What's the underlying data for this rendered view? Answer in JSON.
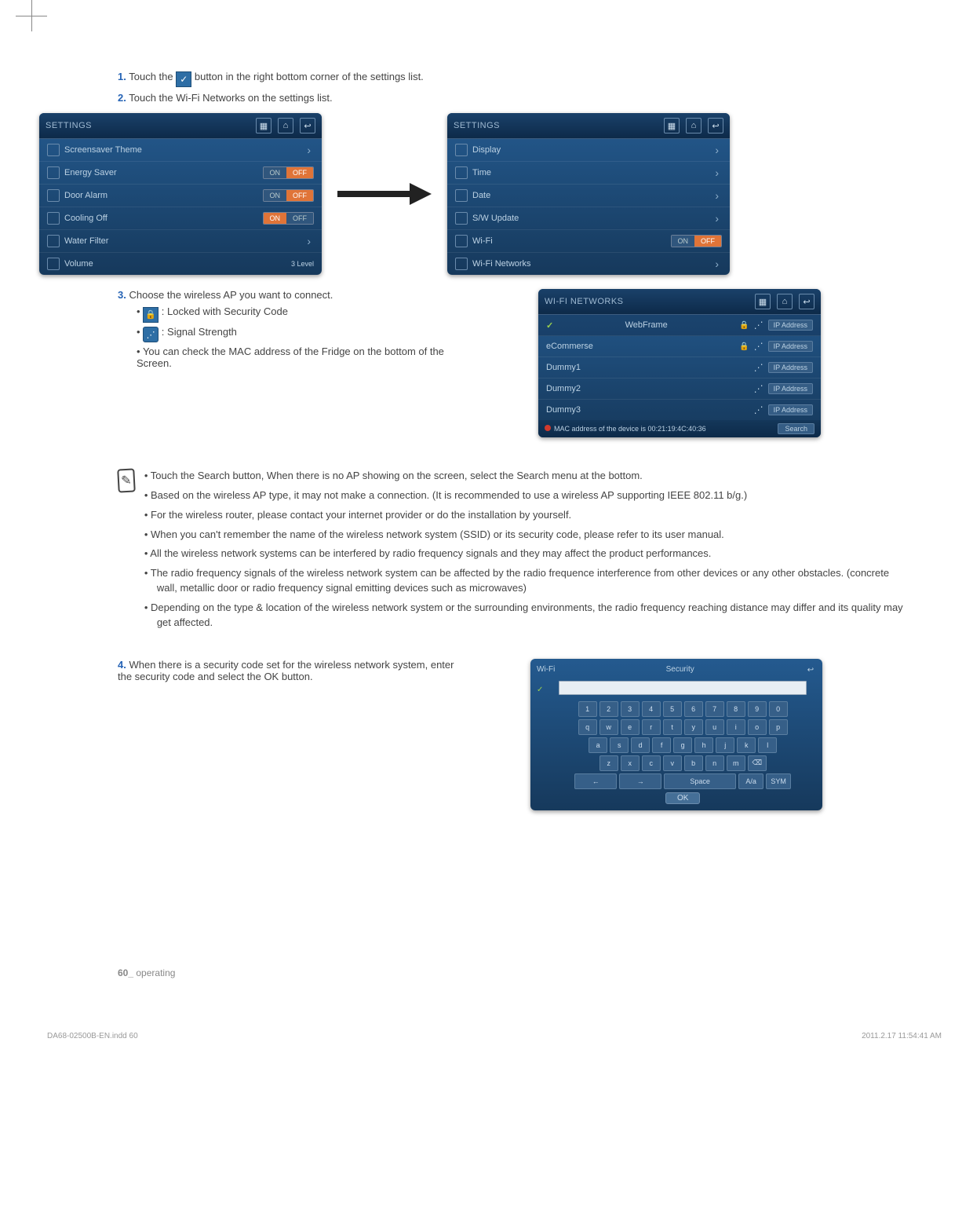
{
  "steps": {
    "s1_prefix": "1.",
    "s1a": "Touch the ",
    "s1b": " button in the right bottom corner of the settings list.",
    "s2_prefix": "2.",
    "s2": "Touch the Wi-Fi Networks on the settings list.",
    "s3_prefix": "3.",
    "s3": "Choose the wireless AP you want to connect.",
    "s3_lock": " : Locked with Security Code",
    "s3_signal": " : Signal Strength",
    "s3_mac": "You can check the MAC address of the Fridge on the bottom of the Screen.",
    "s4_prefix": "4.",
    "s4": "When there is a security code set for the wireless network system, enter the security code and select the OK button."
  },
  "panelA": {
    "title": "SETTINGS",
    "rows": [
      {
        "label": "Screensaver Theme",
        "icon": "image-icon",
        "type": "chev"
      },
      {
        "label": "Energy Saver",
        "icon": "leaf-icon",
        "type": "toggle",
        "on": "ON",
        "off": "OFF",
        "state": "off"
      },
      {
        "label": "Door Alarm",
        "icon": "bell-icon",
        "type": "toggle",
        "on": "ON",
        "off": "OFF",
        "state": "off"
      },
      {
        "label": "Cooling Off",
        "icon": "snow-icon",
        "type": "toggle",
        "on": "ON",
        "off": "OFF",
        "state": "on"
      },
      {
        "label": "Water Filter",
        "icon": "filter-icon",
        "type": "chev"
      },
      {
        "label": "Volume",
        "icon": "vol-icon",
        "type": "level",
        "level": "3 Level"
      }
    ]
  },
  "panelB": {
    "title": "SETTINGS",
    "rows": [
      {
        "label": "Display",
        "icon": "brightness-icon",
        "type": "chev"
      },
      {
        "label": "Time",
        "icon": "clock-icon",
        "type": "chev"
      },
      {
        "label": "Date",
        "icon": "calendar-icon",
        "type": "chev"
      },
      {
        "label": "S/W Update",
        "icon": "update-icon",
        "type": "chev"
      },
      {
        "label": "Wi-Fi",
        "icon": "wifi-icon",
        "type": "toggle",
        "on": "ON",
        "off": "OFF",
        "state": "off"
      },
      {
        "label": "Wi-Fi Networks",
        "icon": "wifi-icon",
        "type": "chev"
      }
    ]
  },
  "wifiPanel": {
    "title": "WI-FI NETWORKS",
    "rows": [
      {
        "label": "WebFrame",
        "lock": true,
        "signal": true,
        "selected": true,
        "btn": "IP Address"
      },
      {
        "label": "eCommerse",
        "lock": true,
        "signal": true,
        "btn": "IP Address"
      },
      {
        "label": "Dummy1",
        "lock": false,
        "signal": true,
        "btn": "IP Address"
      },
      {
        "label": "Dummy2",
        "lock": false,
        "signal": true,
        "btn": "IP Address"
      },
      {
        "label": "Dummy3",
        "lock": false,
        "signal": true,
        "btn": "IP Address"
      }
    ],
    "mac": "MAC address of the device is 00:21:19:4C:40:36",
    "search": "Search"
  },
  "notes": [
    "Touch the Search button, When there is no AP showing on the screen, select the Search menu at the bottom.",
    "Based on the wireless AP type, it may not make a connection. (It is recommended to use a wireless AP supporting IEEE 802.11 b/g.)",
    "For the wireless router, please contact your internet provider or do the installation by yourself.",
    "When you can't remember the name of the wireless network system (SSID) or its security code, please refer to its user manual.",
    "All the wireless network systems can be interfered by radio frequency signals and they may affect the product performances.",
    "The radio frequency signals of the wireless network system can be affected by the radio frequence interference from other devices or any other obstacles. (concrete wall, metallic door or radio frequency signal emitting devices such as microwaves)",
    "Depending on the type & location of the wireless network system or the surrounding environments, the radio frequency reaching distance may differ and its quality may get affected."
  ],
  "keyboard": {
    "top": "Wi-Fi",
    "heading": "Security",
    "rows": [
      [
        "1",
        "2",
        "3",
        "4",
        "5",
        "6",
        "7",
        "8",
        "9",
        "0"
      ],
      [
        "q",
        "w",
        "e",
        "r",
        "t",
        "y",
        "u",
        "i",
        "o",
        "p"
      ],
      [
        "a",
        "s",
        "d",
        "f",
        "g",
        "h",
        "j",
        "k",
        "l"
      ],
      [
        "z",
        "x",
        "c",
        "v",
        "b",
        "n",
        "m",
        "⌫"
      ]
    ],
    "bottom": {
      "left": "←",
      "right": "→",
      "space": "Space",
      "alt": "A/a",
      "sym": "SYM"
    },
    "ok": "OK"
  },
  "footer": {
    "page": "60_",
    "section": "operating"
  },
  "print": {
    "file": "DA68-02500B-EN.indd   60",
    "date": "2011.2.17   11:54:41 AM"
  }
}
